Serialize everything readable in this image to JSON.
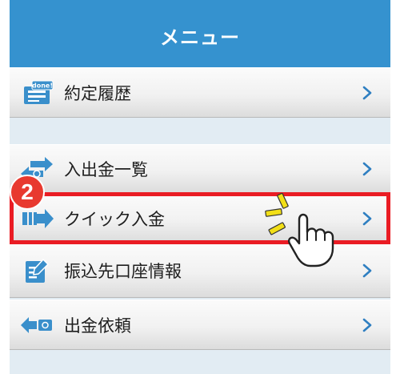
{
  "header": {
    "title": "メニュー"
  },
  "menu": {
    "items": [
      {
        "label": "約定履歴",
        "icon": "done-stamp-icon",
        "icon_text": "done!"
      },
      {
        "label": "入出金一覧",
        "icon": "exchange-arrows-icon"
      },
      {
        "label": "クイック入金",
        "icon": "quick-deposit-icon"
      },
      {
        "label": "振込先口座情報",
        "icon": "edit-document-icon"
      },
      {
        "label": "出金依頼",
        "icon": "withdrawal-icon"
      }
    ]
  },
  "annotation": {
    "step_number": "2",
    "highlight_color": "#ea1c24",
    "badge_color": "#e8392f"
  },
  "colors": {
    "header": "#3592cf",
    "icon": "#3a8fcb",
    "chevron": "#2f7fc1",
    "background": "#e2ecf3"
  }
}
